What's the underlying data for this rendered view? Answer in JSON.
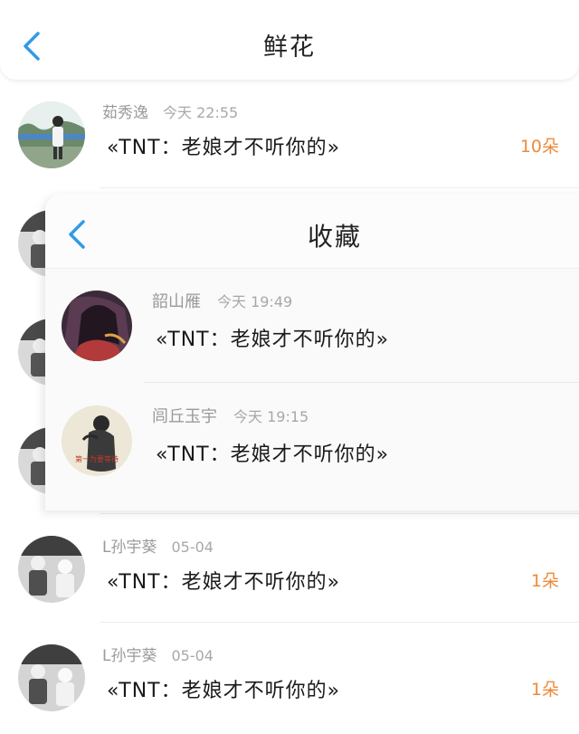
{
  "colors": {
    "accent_blue": "#2f9be8",
    "count_orange": "#ee8a3a",
    "meta_gray": "#9a9a9a"
  },
  "header": {
    "back_icon": "chevron-left-icon",
    "title": "鲜花"
  },
  "flowers": [
    {
      "name": "茹秀逸",
      "time": "今天 22:55",
      "message": "«TNT：老娘才不听你的»",
      "count": "10朵"
    },
    {
      "name": "",
      "time": "",
      "message": "",
      "count": ""
    },
    {
      "name": "",
      "time": "",
      "message": "",
      "count": ""
    },
    {
      "name": "",
      "time": "",
      "message": "",
      "count": ""
    },
    {
      "name": "L孙宇葵",
      "time": "05-04",
      "message": "«TNT：老娘才不听你的»",
      "count": "1朵"
    },
    {
      "name": "L孙宇葵",
      "time": "05-04",
      "message": "«TNT：老娘才不听你的»",
      "count": "1朵"
    }
  ],
  "favorites": {
    "back_icon": "chevron-left-icon",
    "title": "收藏",
    "items": [
      {
        "name": "韶山雁",
        "time": "今天 19:49",
        "message": "«TNT：老娘才不听你的»"
      },
      {
        "name": "闾丘玉宇",
        "time": "今天 19:15",
        "message": "«TNT：老娘才不听你的»",
        "avatar_text": "第一为要等待"
      }
    ]
  }
}
